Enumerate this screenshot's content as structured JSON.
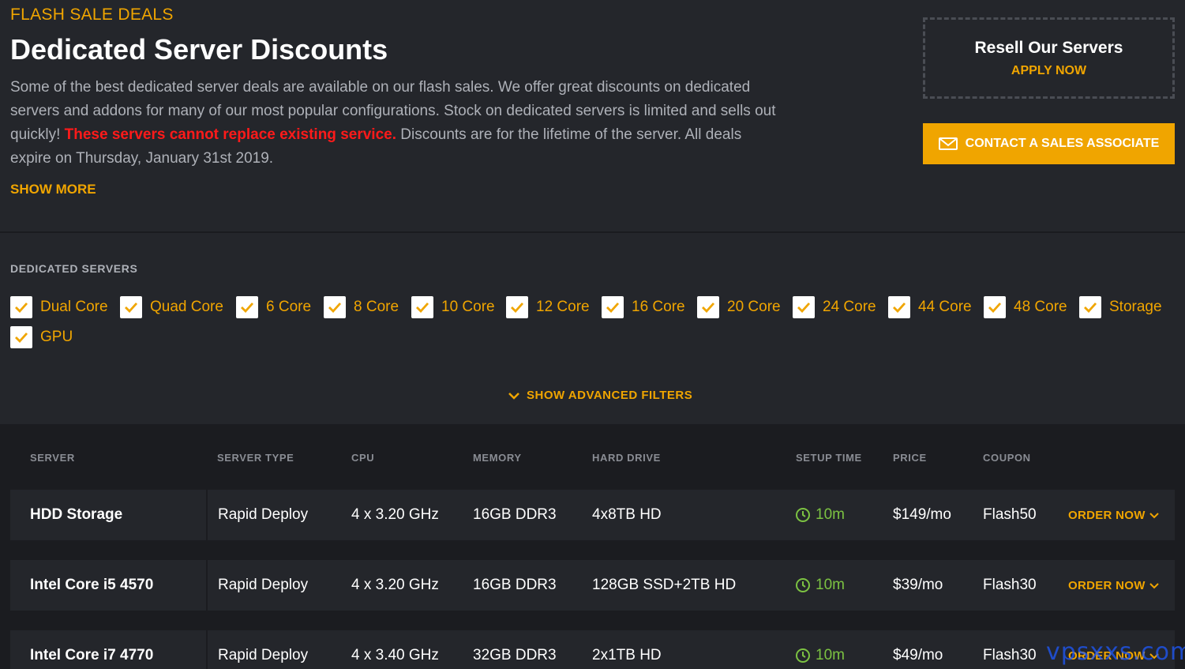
{
  "header": {
    "eyebrow": "FLASH SALE DEALS",
    "title": "Dedicated Server Discounts",
    "desc_part1": "Some of the best dedicated server deals are available on our flash sales. We offer great discounts on dedicated servers and addons for many of our most popular configurations. Stock on dedicated servers is limited and sells out quickly! ",
    "desc_warning": "These servers cannot replace existing service.",
    "desc_part2": " Discounts are for the lifetime of the server. All deals expire on Thursday, January 31st 2019.",
    "show_more": "SHOW MORE"
  },
  "resell": {
    "title": "Resell Our Servers",
    "apply": "APPLY NOW"
  },
  "contact": {
    "label": "CONTACT A SALES ASSOCIATE",
    "icon": "envelope-icon"
  },
  "filters": {
    "label": "DEDICATED SERVERS",
    "options": [
      "Dual Core",
      "Quad Core",
      "6 Core",
      "8 Core",
      "10 Core",
      "12 Core",
      "16 Core",
      "20 Core",
      "24 Core",
      "44 Core",
      "48 Core",
      "Storage",
      "GPU"
    ],
    "advanced": "SHOW ADVANCED FILTERS"
  },
  "table": {
    "headers": [
      "SERVER",
      "SERVER TYPE",
      "CPU",
      "MEMORY",
      "HARD DRIVE",
      "SETUP TIME",
      "PRICE",
      "COUPON"
    ],
    "order_label": "ORDER NOW",
    "rows": [
      {
        "server": "HDD Storage",
        "type": "Rapid Deploy",
        "cpu": "4 x 3.20 GHz",
        "memory": "16GB DDR3",
        "drive": "4x8TB HD",
        "setup": "10m",
        "price": "$149/mo",
        "coupon": "Flash50"
      },
      {
        "server": "Intel Core i5 4570",
        "type": "Rapid Deploy",
        "cpu": "4 x 3.20 GHz",
        "memory": "16GB DDR3",
        "drive": "128GB SSD+2TB HD",
        "setup": "10m",
        "price": "$39/mo",
        "coupon": "Flash30"
      },
      {
        "server": "Intel Core i7 4770",
        "type": "Rapid Deploy",
        "cpu": "4 x 3.40 GHz",
        "memory": "32GB DDR3",
        "drive": "2x1TB HD",
        "setup": "10m",
        "price": "$49/mo",
        "coupon": "Flash30"
      }
    ]
  },
  "watermark": "vpsxxs.com",
  "colors": {
    "accent": "#f0a500",
    "warning": "#ff1a1a",
    "setup": "#7cc242",
    "bg": "#24262b"
  }
}
